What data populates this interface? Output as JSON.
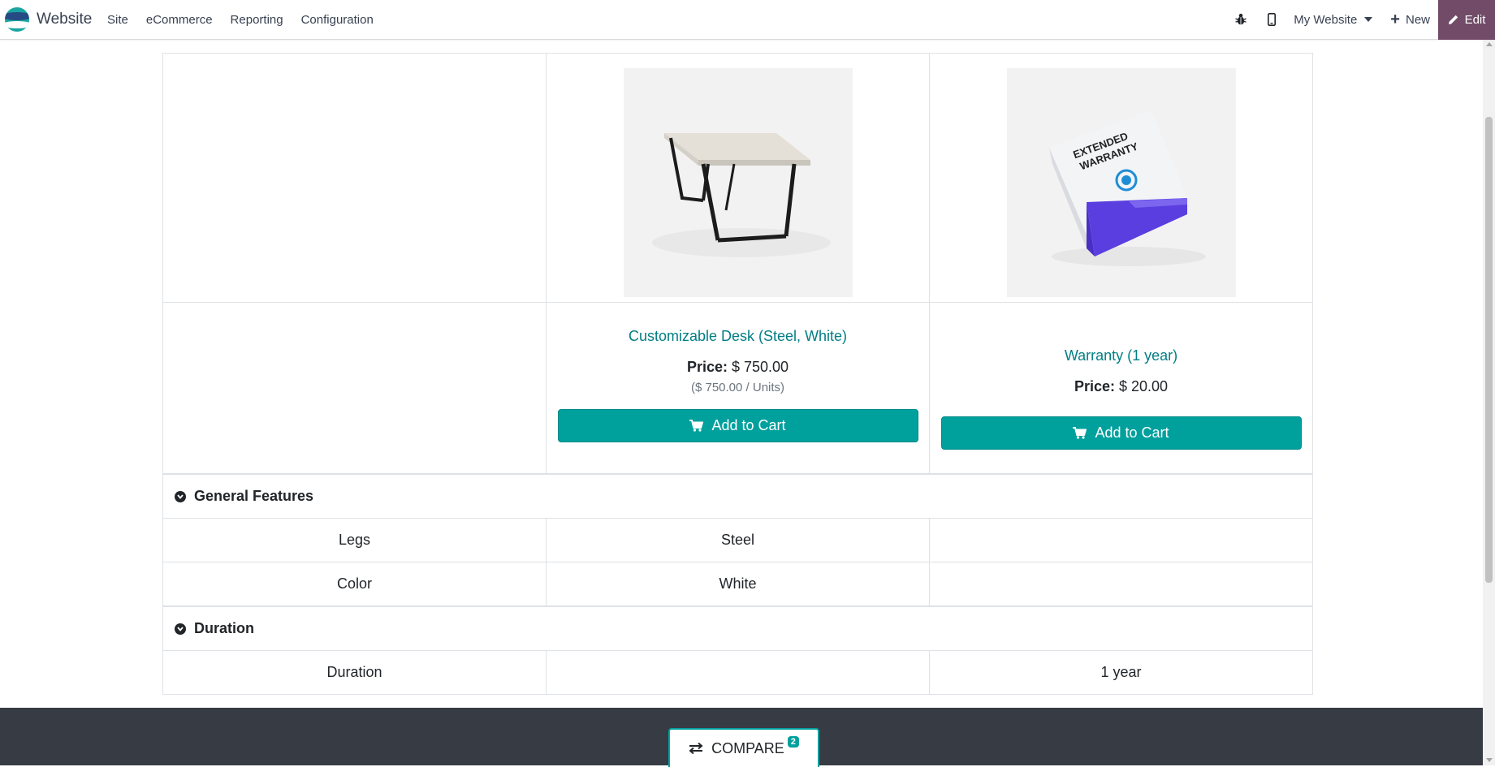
{
  "topbar": {
    "app_name": "Website",
    "menu": [
      "Site",
      "eCommerce",
      "Reporting",
      "Configuration"
    ],
    "website_selector": "My Website",
    "new_label": "New",
    "edit_label": "Edit"
  },
  "products": [
    {
      "name": "Customizable Desk (Steel, White)",
      "price_label": "Price:",
      "price": "$ 750.00",
      "unit_price": "($ 750.00 / Units)",
      "cart_label": "Add to Cart",
      "image": "desk-image"
    },
    {
      "name": "Warranty (1 year)",
      "price_label": "Price:",
      "price": "$ 20.00",
      "cart_label": "Add to Cart",
      "image": "warranty-box-image",
      "box_text": "EXTENDED WARRANTY"
    }
  ],
  "sections": [
    {
      "title": "General Features",
      "rows": [
        {
          "attribute": "Legs",
          "values": [
            "Steel",
            ""
          ]
        },
        {
          "attribute": "Color",
          "values": [
            "White",
            ""
          ]
        }
      ]
    },
    {
      "title": "Duration",
      "rows": [
        {
          "attribute": "Duration",
          "values": [
            "",
            "1 year"
          ]
        }
      ]
    }
  ],
  "compare": {
    "label": "COMPARE",
    "count": "2"
  },
  "colors": {
    "accent": "#00a09d",
    "link": "#017e84",
    "edit": "#714b67",
    "footer": "#373b44"
  }
}
